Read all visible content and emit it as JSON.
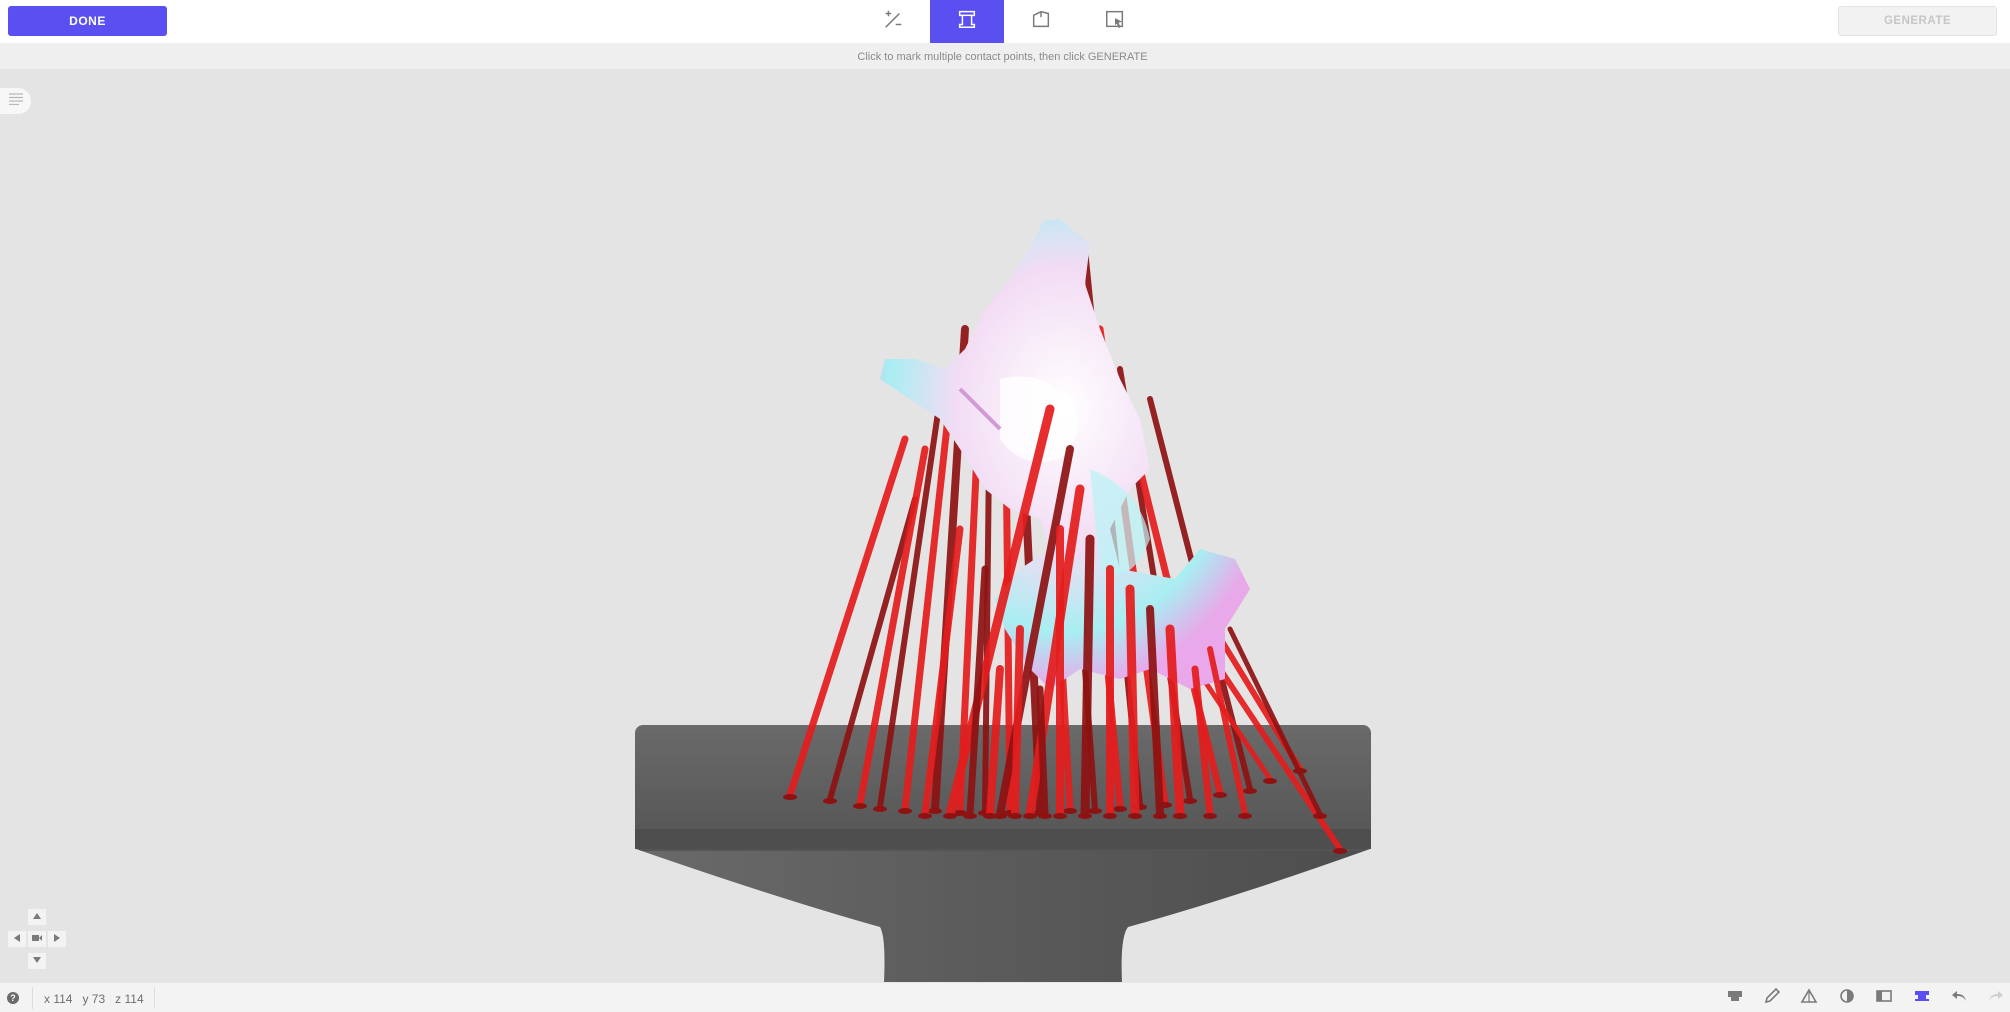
{
  "toolbar": {
    "done_label": "DONE",
    "generate_label": "GENERATE",
    "tools": [
      {
        "name": "auto-generate-tool",
        "icon": "wand-plus-minus-icon",
        "active": false
      },
      {
        "name": "support-tool",
        "icon": "support-pillar-icon",
        "active": true
      },
      {
        "name": "orientation-tool",
        "icon": "cube-side-icon",
        "active": false
      },
      {
        "name": "select-tool",
        "icon": "select-cursor-icon",
        "active": false
      }
    ]
  },
  "hint": "Click to mark multiple contact points, then click GENERATE",
  "status": {
    "help_icon": "?",
    "coords": {
      "x": "x 114",
      "y": "y 73",
      "z": "z 114"
    },
    "icons": [
      "print-icon",
      "pencil-icon",
      "mesh-icon",
      "contrast-icon",
      "layout-icon",
      "support-view-icon",
      "undo-icon",
      "redo-icon"
    ]
  },
  "colors": {
    "accent": "#5a4ff0",
    "support_red": "#e41d1d",
    "support_dark": "#8e1212",
    "platform": "#616161",
    "background": "#e4e4e4"
  }
}
